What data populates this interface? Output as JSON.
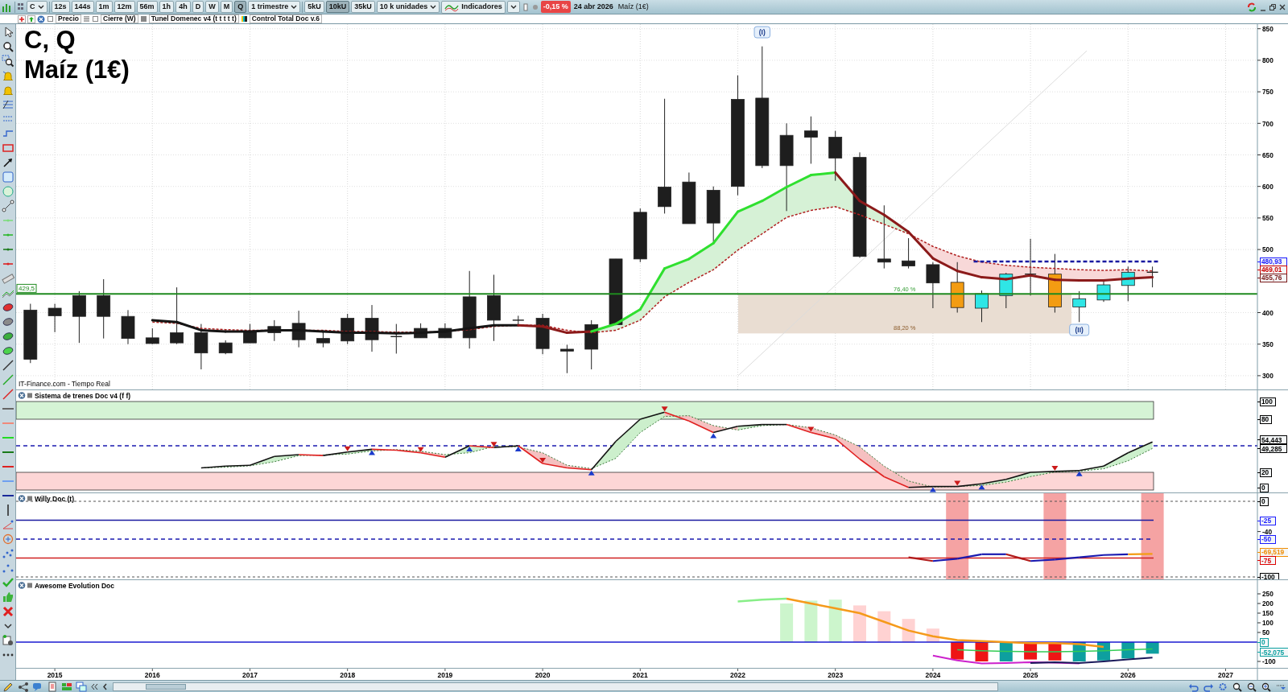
{
  "toolbar": {
    "symbol": "C",
    "timeframes": [
      {
        "label": "12s",
        "selected": false
      },
      {
        "label": "144s",
        "selected": false
      },
      {
        "label": "1m",
        "selected": false
      },
      {
        "label": "12m",
        "selected": false
      },
      {
        "label": "56m",
        "selected": false
      },
      {
        "label": "1h",
        "selected": false
      },
      {
        "label": "4h",
        "selected": false
      },
      {
        "label": "D",
        "selected": false
      },
      {
        "label": "W",
        "selected": false
      },
      {
        "label": "M",
        "selected": false
      },
      {
        "label": "Q",
        "selected": true
      }
    ],
    "period": "1 trimestre",
    "unit_buttons": [
      {
        "label": "5kU",
        "selected": false
      },
      {
        "label": "10kU",
        "selected": true
      },
      {
        "label": "35kU",
        "selected": false
      }
    ],
    "units": "10 k unidades",
    "indicators": "Indicadores",
    "change": "-0,15 %",
    "date": "24 abr 2026",
    "instrument": "Maíz (1€)"
  },
  "legend": [
    "Precio",
    "Cierre (W)",
    "Tunel Domenec v4 (t t t t t)",
    "Control Total Doc v.6"
  ],
  "main_chart": {
    "title": "C, Q",
    "subtitle": "Maíz (1€)",
    "source": "IT-Finance.com - Tiempo Real",
    "support_label": "429,5",
    "wave_labels": [
      "(I)",
      "(II)"
    ],
    "fib_labels": [
      "76,40 %",
      "88,20 %"
    ],
    "y_axis": [
      "850",
      "800",
      "750",
      "700",
      "650",
      "600",
      "550",
      "500",
      "400",
      "350",
      "300"
    ],
    "price_tags": [
      {
        "text": "480,93",
        "color": "#1a1aff"
      },
      {
        "text": "469,01",
        "color": "#cc0000"
      },
      {
        "text": "455,76",
        "color": "#7a1a1a"
      }
    ]
  },
  "panes": [
    {
      "title": "Sistema de trenes Doc v4 (f f)",
      "axis_labels": [
        {
          "text": "100",
          "kind": "tag",
          "color": "#000000"
        },
        {
          "text": "80",
          "kind": "tag",
          "color": "#000000"
        },
        {
          "text": "54,443",
          "kind": "tag",
          "color": "#000000"
        },
        {
          "text": "49,285",
          "kind": "tag",
          "color": "#000000"
        },
        {
          "text": "20",
          "kind": "tag",
          "color": "#000000"
        },
        {
          "text": "0",
          "kind": "tag",
          "color": "#000000"
        }
      ]
    },
    {
      "title": "Willy Doc (t)",
      "axis_labels": [
        {
          "text": "0",
          "kind": "tag",
          "color": "#000000"
        },
        {
          "text": "-25",
          "kind": "tag",
          "color": "#1a1aff"
        },
        {
          "text": "-40",
          "kind": "tick"
        },
        {
          "text": "-50",
          "kind": "tag",
          "color": "#1a1aff"
        },
        {
          "text": "-69,519",
          "kind": "tag",
          "color": "#f08c00"
        },
        {
          "text": "-75",
          "kind": "tag",
          "color": "#dd0000"
        },
        {
          "text": "-100",
          "kind": "tag",
          "color": "#000000"
        }
      ]
    },
    {
      "title": "Awesome Evolution Doc",
      "axis_labels": [
        {
          "text": "250",
          "kind": "tick"
        },
        {
          "text": "200",
          "kind": "tick"
        },
        {
          "text": "150",
          "kind": "tick"
        },
        {
          "text": "100",
          "kind": "tick"
        },
        {
          "text": "50",
          "kind": "tick"
        },
        {
          "text": "0",
          "kind": "tag",
          "color": "#0aa0a0"
        },
        {
          "text": "-52,075",
          "kind": "tag",
          "color": "#0aa0a0"
        },
        {
          "text": "-100",
          "kind": "tick"
        }
      ]
    }
  ],
  "x_axis": [
    "2015",
    "2016",
    "2017",
    "2018",
    "2019",
    "2020",
    "2021",
    "2022",
    "2023",
    "2024",
    "2025",
    "2026",
    "2027"
  ]
}
